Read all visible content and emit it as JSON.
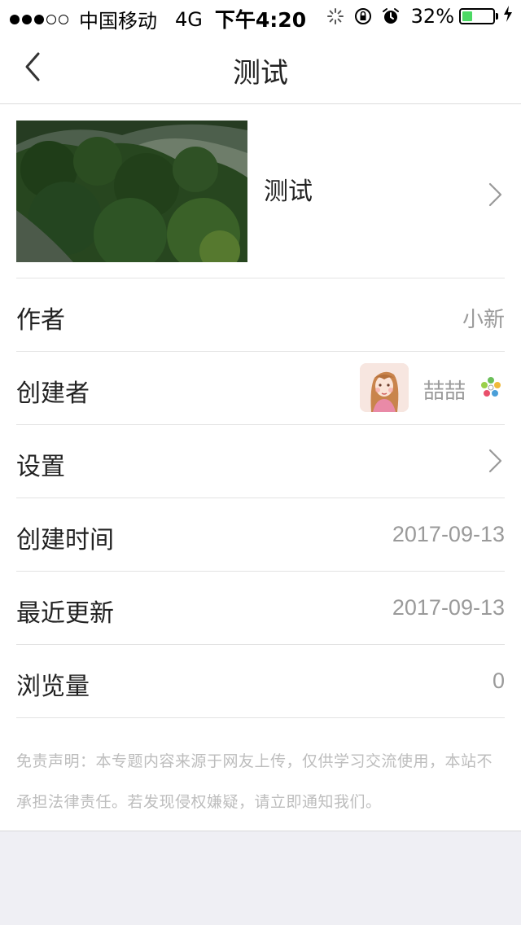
{
  "status_bar": {
    "signal_dots_filled": 3,
    "signal_dots_total": 5,
    "carrier": "中国移动",
    "network": "4G",
    "time": "下午4:20",
    "battery_percent": "32%",
    "battery_level": 0.32,
    "icons": [
      "activity-spinner-icon",
      "rotation-lock-icon",
      "alarm-icon",
      "charging-bolt-icon"
    ]
  },
  "nav": {
    "back_icon": "chevron-left-icon",
    "title": "测试"
  },
  "cover": {
    "image": "mountain-landscape-image",
    "title": "测试",
    "chevron": "chevron-right-icon"
  },
  "rows": {
    "author": {
      "label": "作者",
      "value": "小新"
    },
    "creator": {
      "label": "创建者",
      "name": "喆喆",
      "avatar": "avatar-illustration",
      "badge_icon": "flower-badge-icon"
    },
    "settings": {
      "label": "设置",
      "chevron": "chevron-right-icon"
    },
    "created": {
      "label": "创建时间",
      "value": "2017-09-13"
    },
    "updated": {
      "label": "最近更新",
      "value": "2017-09-13"
    },
    "views": {
      "label": "浏览量",
      "value": "0"
    }
  },
  "disclaimer": "免责声明：本专题内容来源于网友上传，仅供学习交流使用，本站不承担法律责任。若发现侵权嫌疑，请立即通知我们。",
  "colors": {
    "battery_fill": "#4cd964",
    "page_background": "#efeff4",
    "secondary_text": "#9a9a9a",
    "disclaimer_text": "#bdbdbd"
  }
}
